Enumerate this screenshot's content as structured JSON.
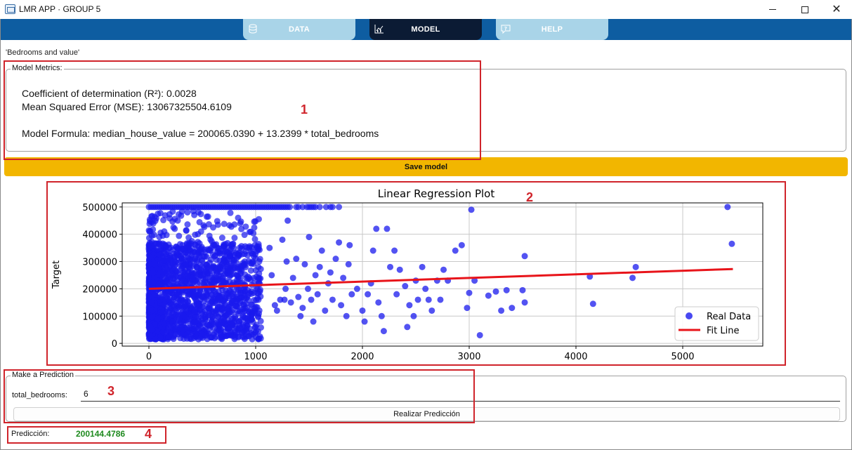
{
  "window": {
    "title": "LMR APP · GROUP 5"
  },
  "nav": {
    "tabs": [
      {
        "label": "DATA",
        "icon": "database-icon"
      },
      {
        "label": "MODEL",
        "icon": "chart-icon"
      },
      {
        "label": "HELP",
        "icon": "help-icon"
      }
    ],
    "active_tab": "MODEL"
  },
  "dataset_label": "'Bedrooms and value'",
  "metrics": {
    "group_title": "Model Metrics:",
    "r2": "Coefficient of determination (R²): 0.0028",
    "mse": "Mean Squared Error (MSE): 13067325504.6109",
    "formula": "Model Formula: median_house_value = 200065.0390 + 13.2399 * total_bedrooms"
  },
  "save_button": "Save model",
  "prediction": {
    "group_title": "Make a Prediction",
    "field_label": "total_bedrooms:",
    "field_value": "6",
    "button_label": "Realizar Predicción",
    "result_label": "Predicción:",
    "result_value": "200144.4786"
  },
  "annotations": [
    "1",
    "2",
    "3",
    "4"
  ],
  "colors": {
    "nav_bg": "#0e5da1",
    "active_tab": "#0b1b34",
    "inactive_tab": "#a9d4e8",
    "save": "#f2b600",
    "points": "#1a1aee",
    "fit_line": "#e8141a",
    "result": "#1f8a1f",
    "annotation": "#d0242b"
  },
  "chart_data": {
    "type": "scatter",
    "title": "Linear Regression Plot",
    "xlabel": "",
    "ylabel": "Target",
    "xlim": [
      -250,
      5750
    ],
    "ylim": [
      -10000,
      515000
    ],
    "xticks": [
      0,
      1000,
      2000,
      3000,
      4000,
      5000
    ],
    "yticks": [
      0,
      100000,
      200000,
      300000,
      400000,
      500000
    ],
    "grid": true,
    "legend": {
      "position": "bottom-right",
      "entries": [
        "Real Data",
        "Fit Line"
      ]
    },
    "series": [
      {
        "name": "Real Data",
        "kind": "points",
        "points": [
          [
            1130,
            350000
          ],
          [
            1150,
            250000
          ],
          [
            1180,
            140000
          ],
          [
            1200,
            120000
          ],
          [
            1230,
            160000
          ],
          [
            1250,
            380000
          ],
          [
            1270,
            160000
          ],
          [
            1280,
            200000
          ],
          [
            1290,
            300000
          ],
          [
            1300,
            450000
          ],
          [
            1330,
            150000
          ],
          [
            1350,
            240000
          ],
          [
            1380,
            310000
          ],
          [
            1400,
            170000
          ],
          [
            1420,
            100000
          ],
          [
            1440,
            130000
          ],
          [
            1460,
            290000
          ],
          [
            1490,
            200000
          ],
          [
            1500,
            390000
          ],
          [
            1520,
            160000
          ],
          [
            1540,
            80000
          ],
          [
            1560,
            250000
          ],
          [
            1580,
            180000
          ],
          [
            1600,
            280000
          ],
          [
            1620,
            340000
          ],
          [
            1650,
            120000
          ],
          [
            1680,
            220000
          ],
          [
            1700,
            260000
          ],
          [
            1720,
            160000
          ],
          [
            1750,
            310000
          ],
          [
            1780,
            370000
          ],
          [
            1800,
            140000
          ],
          [
            1820,
            240000
          ],
          [
            1850,
            100000
          ],
          [
            1870,
            290000
          ],
          [
            1880,
            360000
          ],
          [
            1900,
            180000
          ],
          [
            1950,
            200000
          ],
          [
            2000,
            120000
          ],
          [
            2020,
            80000
          ],
          [
            2050,
            180000
          ],
          [
            2080,
            220000
          ],
          [
            2100,
            340000
          ],
          [
            2130,
            420000
          ],
          [
            2150,
            150000
          ],
          [
            2180,
            100000
          ],
          [
            2200,
            45000
          ],
          [
            2230,
            420000
          ],
          [
            2260,
            280000
          ],
          [
            2300,
            340000
          ],
          [
            2320,
            180000
          ],
          [
            2350,
            270000
          ],
          [
            2400,
            210000
          ],
          [
            2420,
            60000
          ],
          [
            2440,
            140000
          ],
          [
            2480,
            100000
          ],
          [
            2500,
            230000
          ],
          [
            2520,
            160000
          ],
          [
            2560,
            280000
          ],
          [
            2590,
            200000
          ],
          [
            2620,
            160000
          ],
          [
            2650,
            120000
          ],
          [
            2700,
            230000
          ],
          [
            2730,
            160000
          ],
          [
            2760,
            270000
          ],
          [
            2800,
            230000
          ],
          [
            2870,
            340000
          ],
          [
            2930,
            360000
          ],
          [
            2980,
            130000
          ],
          [
            3000,
            185000
          ],
          [
            3020,
            490000
          ],
          [
            3050,
            230000
          ],
          [
            3100,
            30000
          ],
          [
            3180,
            175000
          ],
          [
            3250,
            190000
          ],
          [
            3300,
            120000
          ],
          [
            3350,
            195000
          ],
          [
            3400,
            130000
          ],
          [
            3500,
            195000
          ],
          [
            3520,
            150000
          ],
          [
            3520,
            320000
          ],
          [
            4130,
            245000
          ],
          [
            4160,
            145000
          ],
          [
            4530,
            240000
          ],
          [
            4560,
            280000
          ],
          [
            5420,
            500000
          ],
          [
            5460,
            365000
          ]
        ]
      },
      {
        "name": "Fit Line",
        "kind": "line",
        "points": [
          [
            0,
            200065
          ],
          [
            5470,
            272488
          ]
        ]
      }
    ]
  }
}
